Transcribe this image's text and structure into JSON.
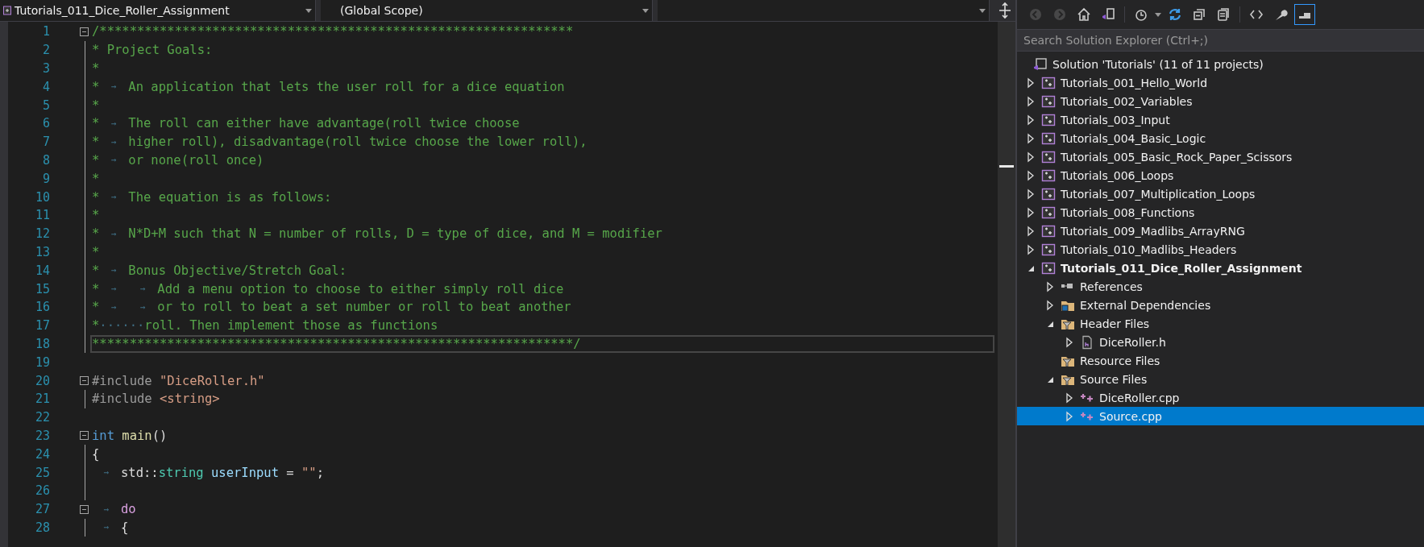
{
  "editor": {
    "nav_bar": {
      "project": "Tutorials_011_Dice_Roller_Assignment",
      "scope": "(Global Scope)"
    },
    "lines": [
      {
        "number": "1",
        "fold": true,
        "current": false,
        "tokens": [
          {
            "kind": "comment",
            "text": "/***************************************************************"
          }
        ]
      },
      {
        "number": "2",
        "fold": false,
        "guide": true,
        "current": false,
        "tokens": [
          {
            "kind": "comment",
            "text": "* Project Goals:"
          }
        ]
      },
      {
        "number": "3",
        "fold": false,
        "guide": true,
        "current": false,
        "tokens": [
          {
            "kind": "comment",
            "text": "*"
          }
        ]
      },
      {
        "number": "4",
        "fold": false,
        "guide": true,
        "current": false,
        "tokens": [
          {
            "kind": "comment",
            "text": "*"
          },
          {
            "kind": "tab",
            "text": "→"
          },
          {
            "kind": "comment",
            "text": "An application that lets the user roll for a dice equation"
          }
        ]
      },
      {
        "number": "5",
        "fold": false,
        "guide": true,
        "current": false,
        "tokens": [
          {
            "kind": "comment",
            "text": "*"
          }
        ]
      },
      {
        "number": "6",
        "fold": false,
        "guide": true,
        "current": false,
        "tokens": [
          {
            "kind": "comment",
            "text": "*"
          },
          {
            "kind": "tab",
            "text": "→"
          },
          {
            "kind": "comment",
            "text": "The roll can either have advantage(roll twice choose"
          }
        ]
      },
      {
        "number": "7",
        "fold": false,
        "guide": true,
        "current": false,
        "tokens": [
          {
            "kind": "comment",
            "text": "*"
          },
          {
            "kind": "tab",
            "text": "→"
          },
          {
            "kind": "comment",
            "text": "higher roll), disadvantage(roll twice choose the lower roll),"
          }
        ]
      },
      {
        "number": "8",
        "fold": false,
        "guide": true,
        "current": false,
        "tokens": [
          {
            "kind": "comment",
            "text": "*"
          },
          {
            "kind": "tab",
            "text": "→"
          },
          {
            "kind": "comment",
            "text": "or none(roll once)"
          }
        ]
      },
      {
        "number": "9",
        "fold": false,
        "guide": true,
        "current": false,
        "tokens": [
          {
            "kind": "comment",
            "text": "*"
          }
        ]
      },
      {
        "number": "10",
        "fold": false,
        "guide": true,
        "current": false,
        "tokens": [
          {
            "kind": "comment",
            "text": "*"
          },
          {
            "kind": "tab",
            "text": "→"
          },
          {
            "kind": "comment",
            "text": "The equation is as follows:"
          }
        ]
      },
      {
        "number": "11",
        "fold": false,
        "guide": true,
        "current": false,
        "tokens": [
          {
            "kind": "comment",
            "text": "*"
          }
        ]
      },
      {
        "number": "12",
        "fold": false,
        "guide": true,
        "current": false,
        "tokens": [
          {
            "kind": "comment",
            "text": "*"
          },
          {
            "kind": "tab",
            "text": "→"
          },
          {
            "kind": "comment",
            "text": "N*D+M such that N = number of rolls, D = type of dice, and M = modifier"
          }
        ]
      },
      {
        "number": "13",
        "fold": false,
        "guide": true,
        "current": false,
        "tokens": [
          {
            "kind": "comment",
            "text": "*"
          }
        ]
      },
      {
        "number": "14",
        "fold": false,
        "guide": true,
        "current": false,
        "tokens": [
          {
            "kind": "comment",
            "text": "*"
          },
          {
            "kind": "tab",
            "text": "→"
          },
          {
            "kind": "comment",
            "text": "Bonus Objective/Stretch Goal:"
          }
        ]
      },
      {
        "number": "15",
        "fold": false,
        "guide": true,
        "current": false,
        "tokens": [
          {
            "kind": "comment",
            "text": "*"
          },
          {
            "kind": "tab",
            "text": "→"
          },
          {
            "kind": "tab",
            "text": "→"
          },
          {
            "kind": "comment",
            "text": "Add a menu option to choose to either simply roll dice"
          }
        ]
      },
      {
        "number": "16",
        "fold": false,
        "guide": true,
        "current": false,
        "tokens": [
          {
            "kind": "comment",
            "text": "*"
          },
          {
            "kind": "tab",
            "text": "→"
          },
          {
            "kind": "tab",
            "text": "→"
          },
          {
            "kind": "comment",
            "text": "or to roll to beat a set number or roll to beat another"
          }
        ]
      },
      {
        "number": "17",
        "fold": false,
        "guide": true,
        "current": false,
        "tokens": [
          {
            "kind": "comment",
            "text": "*"
          },
          {
            "kind": "space",
            "text": "······"
          },
          {
            "kind": "comment",
            "text": "roll. Then implement those as functions"
          }
        ]
      },
      {
        "number": "18",
        "fold": false,
        "guide": true,
        "current": true,
        "tokens": [
          {
            "kind": "comment",
            "text": "****************************************************************/"
          }
        ]
      },
      {
        "number": "19",
        "fold": false,
        "guide": false
      },
      {
        "number": "20",
        "fold": true,
        "current": false,
        "tokens": [
          {
            "kind": "preprocessor",
            "text": "#include"
          },
          {
            "kind": "string",
            "text": " \"DiceRoller.h\""
          }
        ]
      },
      {
        "number": "21",
        "fold": false,
        "guide": true,
        "current": false,
        "tokens": [
          {
            "kind": "preprocessor",
            "text": "#include"
          },
          {
            "kind": "string",
            "text": " <string>"
          }
        ]
      },
      {
        "number": "22",
        "fold": false,
        "guide": false
      },
      {
        "number": "23",
        "fold": true,
        "current": false,
        "tokens": [
          {
            "kind": "keyword",
            "text": "int"
          },
          {
            "kind": "function",
            "text": " main"
          },
          {
            "kind": "plain",
            "text": "()"
          }
        ]
      },
      {
        "number": "24",
        "fold": false,
        "guide": true,
        "current": false,
        "tokens": [
          {
            "kind": "plain",
            "text": "{"
          }
        ]
      },
      {
        "number": "25",
        "fold": false,
        "guide": true,
        "current": false,
        "tokens": [
          {
            "kind": "tab",
            "text": "→"
          },
          {
            "kind": "plain",
            "text": "std::"
          },
          {
            "kind": "type",
            "text": "string"
          },
          {
            "kind": "variable",
            "text": " userInput"
          },
          {
            "kind": "plain",
            "text": " = "
          },
          {
            "kind": "string",
            "text": "\"\""
          },
          {
            "kind": "plain",
            "text": ";"
          }
        ]
      },
      {
        "number": "26",
        "fold": false,
        "guide": true
      },
      {
        "number": "27",
        "fold": true,
        "current": false,
        "tokens": [
          {
            "kind": "tab",
            "text": "→"
          },
          {
            "kind": "control",
            "text": "do"
          }
        ]
      },
      {
        "number": "28",
        "fold": false,
        "guide": true,
        "current": false,
        "tokens": [
          {
            "kind": "tab",
            "text": "→"
          },
          {
            "kind": "plain",
            "text": "{"
          }
        ]
      }
    ]
  },
  "solution_explorer": {
    "search": {
      "placeholder": "Search Solution Explorer (Ctrl+;)"
    },
    "toolbar": [
      {
        "kind": "back",
        "disabled": true,
        "selected": false
      },
      {
        "kind": "forward",
        "disabled": true,
        "selected": false
      },
      {
        "kind": "home",
        "disabled": false,
        "selected": false
      },
      {
        "kind": "solution-view",
        "disabled": false,
        "selected": false
      },
      {
        "kind": "history",
        "disabled": false,
        "selected": false
      },
      {
        "kind": "sync",
        "disabled": false,
        "selected": false
      },
      {
        "kind": "collapse",
        "disabled": false,
        "selected": false
      },
      {
        "kind": "show-all",
        "disabled": false,
        "selected": false
      },
      {
        "kind": "code",
        "disabled": false,
        "selected": false
      },
      {
        "kind": "properties",
        "disabled": false,
        "selected": false
      },
      {
        "kind": "preview",
        "disabled": false,
        "selected": true
      }
    ],
    "tree": [
      {
        "kind": "solution",
        "label": "Solution 'Tutorials' (11 of 11 projects)",
        "selected": false
      },
      {
        "kind": "project",
        "label": "Tutorials_001_Hello_World",
        "expanded": false,
        "startup": false,
        "selected": false
      },
      {
        "kind": "project",
        "label": "Tutorials_002_Variables",
        "expanded": false,
        "startup": false,
        "selected": false
      },
      {
        "kind": "project",
        "label": "Tutorials_003_Input",
        "expanded": false,
        "startup": false,
        "selected": false
      },
      {
        "kind": "project",
        "label": "Tutorials_004_Basic_Logic",
        "expanded": false,
        "startup": false,
        "selected": false
      },
      {
        "kind": "project",
        "label": "Tutorials_005_Basic_Rock_Paper_Scissors",
        "expanded": false,
        "startup": false,
        "selected": false
      },
      {
        "kind": "project",
        "label": "Tutorials_006_Loops",
        "expanded": false,
        "startup": false,
        "selected": false
      },
      {
        "kind": "project",
        "label": "Tutorials_007_Multiplication_Loops",
        "expanded": false,
        "startup": false,
        "selected": false
      },
      {
        "kind": "project",
        "label": "Tutorials_008_Functions",
        "expanded": false,
        "startup": false,
        "selected": false
      },
      {
        "kind": "project",
        "label": "Tutorials_009_Madlibs_ArrayRNG",
        "expanded": false,
        "startup": false,
        "selected": false
      },
      {
        "kind": "project",
        "label": "Tutorials_010_Madlibs_Headers",
        "expanded": false,
        "startup": false,
        "selected": false
      },
      {
        "kind": "project",
        "label": "Tutorials_011_Dice_Roller_Assignment",
        "expanded": true,
        "startup": true,
        "selected": false,
        "children": [
          {
            "kind": "references",
            "label": "References",
            "expanded": false,
            "selected": false
          },
          {
            "kind": "external",
            "label": "External Dependencies",
            "expanded": false,
            "selected": false
          },
          {
            "kind": "filter",
            "label": "Header Files",
            "expanded": true,
            "selected": false,
            "children": [
              {
                "kind": "header",
                "label": "DiceRoller.h",
                "expanded": false,
                "selected": false
              }
            ]
          },
          {
            "kind": "filter",
            "label": "Resource Files",
            "selected": false
          },
          {
            "kind": "filter",
            "label": "Source Files",
            "expanded": true,
            "selected": false,
            "children": [
              {
                "kind": "cpp",
                "label": "DiceRoller.cpp",
                "expanded": false,
                "selected": false
              },
              {
                "kind": "cpp",
                "label": "Source.cpp",
                "expanded": false,
                "selected": true
              }
            ]
          }
        ]
      }
    ]
  }
}
